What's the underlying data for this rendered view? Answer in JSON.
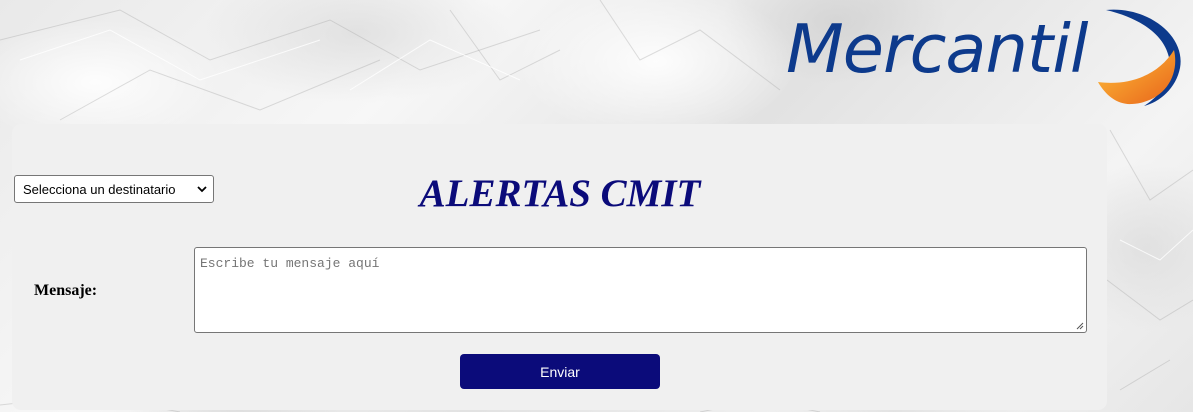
{
  "brand": {
    "name": "Mercantil",
    "text_color": "#0d3a8c",
    "mark_colors": [
      "#0d3a8c",
      "#f5a623",
      "#e8731a"
    ]
  },
  "recipient_select": {
    "selected": "Selecciona un destinatario",
    "icon": "chevron-down-icon"
  },
  "page_title": "ALERTAS CMIT",
  "message": {
    "label": "Mensaje:",
    "value": "",
    "placeholder": "Escribe tu mensaje aquí"
  },
  "send_button": {
    "label": "Enviar",
    "color": "#0b0b7a"
  },
  "colors": {
    "title": "#0b0b7a",
    "panel": "#f0f0f0"
  }
}
